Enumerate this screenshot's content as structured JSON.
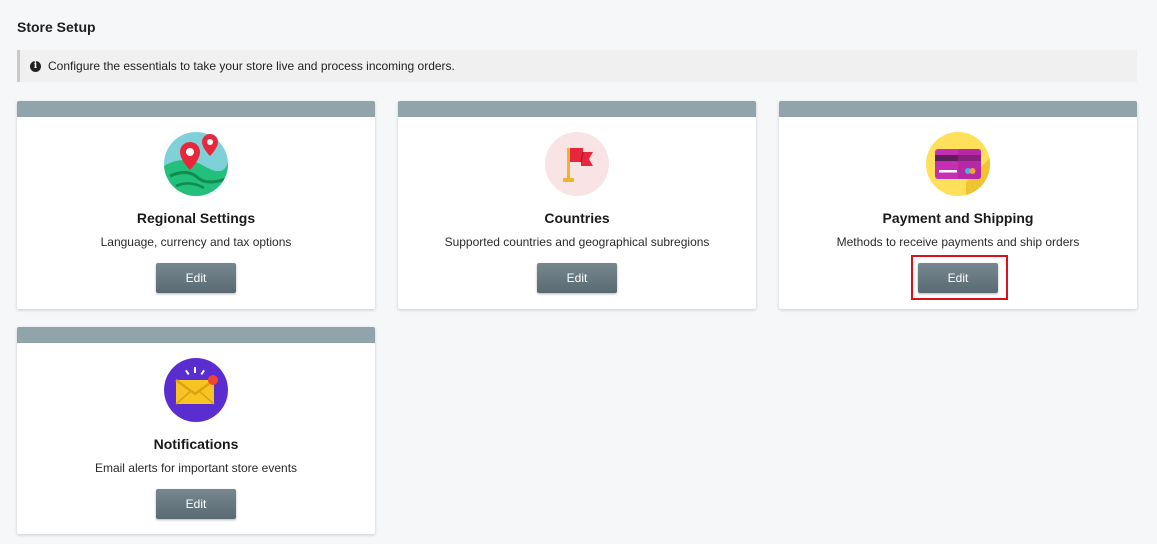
{
  "page": {
    "title": "Store Setup",
    "info": "Configure the essentials to take your store live and process incoming orders."
  },
  "cards": [
    {
      "title": "Regional Settings",
      "description": "Language, currency and tax options",
      "button": "Edit",
      "icon": "map-pin-icon"
    },
    {
      "title": "Countries",
      "description": "Supported countries and geographical subregions",
      "button": "Edit",
      "icon": "flag-icon"
    },
    {
      "title": "Payment and Shipping",
      "description": "Methods to receive payments and ship orders",
      "button": "Edit",
      "icon": "credit-card-icon"
    },
    {
      "title": "Notifications",
      "description": "Email alerts for important store events",
      "button": "Edit",
      "icon": "envelope-icon"
    }
  ],
  "colors": {
    "card_header": "#92a4ab",
    "button": "#66767e",
    "highlight": "#e0101a"
  }
}
